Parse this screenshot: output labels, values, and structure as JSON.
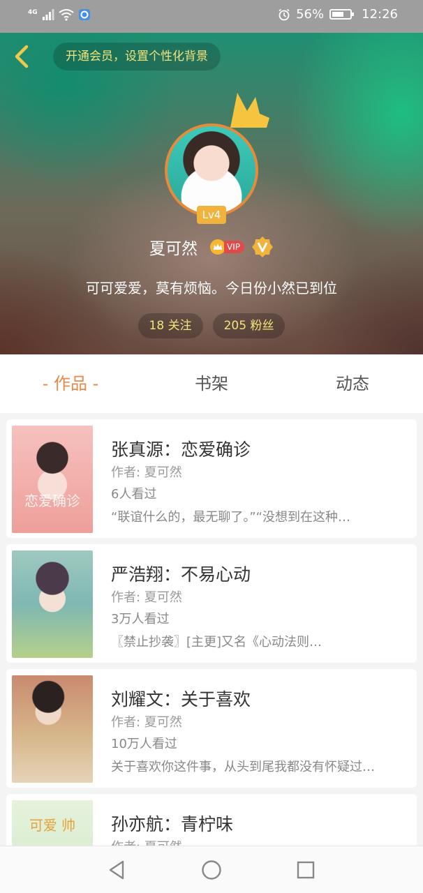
{
  "status_bar": {
    "network": "4G",
    "battery": "56%",
    "battery_level": 0.56,
    "time": "12:26",
    "icons": [
      "signal-icon",
      "wifi-icon",
      "app-notification-icon",
      "alarm-icon",
      "battery-icon"
    ]
  },
  "header": {
    "back_icon": "chevron-left-icon",
    "vip_banner": "开通会员，设置个性化背景",
    "level": "Lv4",
    "username": "夏可然",
    "vip_label": "VIP",
    "bio": "可可爱爱，莫有烦恼。今日份小然已到位",
    "following": "18 关注",
    "followers": "205 粉丝"
  },
  "tabs": [
    {
      "label": "- 作品 -",
      "active": true
    },
    {
      "label": "书架",
      "active": false
    },
    {
      "label": "动态",
      "active": false
    }
  ],
  "works": [
    {
      "title": "张真源：恋爱确诊",
      "author": "作者: 夏可然",
      "views": "6人看过",
      "desc": "“联谊什么的，最无聊了。”“没想到在这种…",
      "cover_text": "恋爱确诊",
      "cover_color": "#f3a6a4"
    },
    {
      "title": "严浩翔：不易心动",
      "author": "作者: 夏可然",
      "views": "3万人看过",
      "desc": "〖禁止抄袭〗[主更]又名《心动法则…",
      "cover_text": "",
      "cover_color": "#7fb7b2"
    },
    {
      "title": "刘耀文：关于喜欢",
      "author": "作者: 夏可然",
      "views": "10万人看过",
      "desc": "关于喜欢你这件事，从头到尾我都没有怀疑过…",
      "cover_text": "",
      "cover_color": "#d6b58a"
    },
    {
      "title": "孙亦航：青柠味",
      "author": "作者: 夏可然",
      "views": "",
      "desc": "",
      "cover_text": "可爱 帅",
      "cover_color": "#cfe8c8"
    }
  ],
  "colors": {
    "accent": "#e8894a",
    "gold": "#f6e27a",
    "level_badge": "#f2b33d",
    "vip_red": "#e24a4a"
  },
  "navbar": {
    "icons": [
      "back-triangle-icon",
      "home-circle-icon",
      "recents-square-icon"
    ]
  }
}
